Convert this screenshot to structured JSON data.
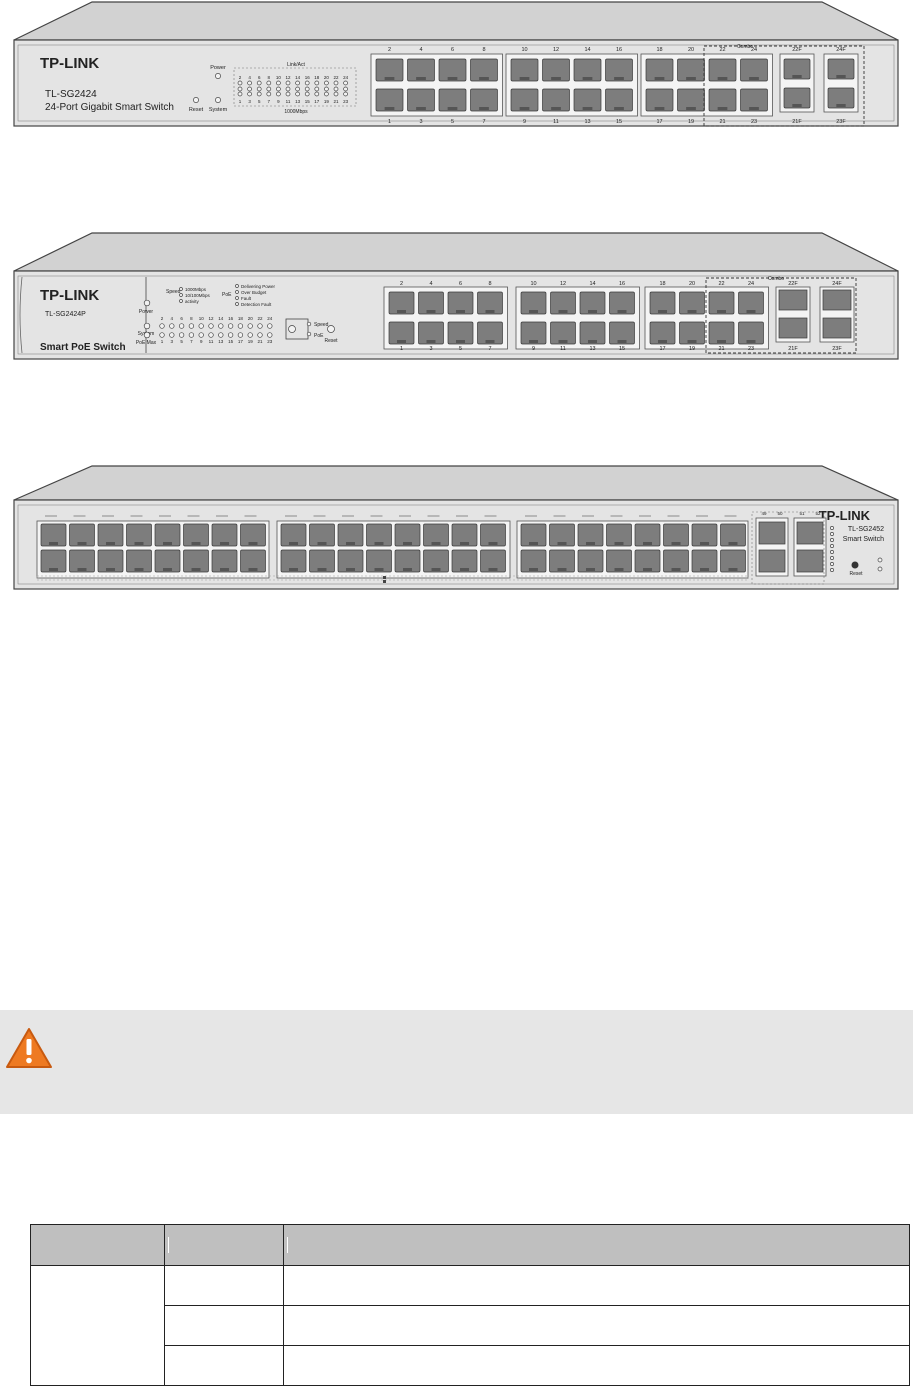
{
  "figures": {
    "switch_1": {
      "brand": "TP-LINK",
      "model": "TL-SG2424",
      "name": "24-Port Gigabit Smart Switch",
      "power_label": "Power",
      "reset_label": "Reset",
      "system_label": "System",
      "link_act_label": "Link/Act",
      "speed_label": "1000Mbps",
      "combo_label": "Combo",
      "led_top_numbers": [
        "2",
        "4",
        "6",
        "8",
        "10",
        "12",
        "14",
        "16",
        "18",
        "20",
        "22",
        "24"
      ],
      "led_bottom_numbers": [
        "1",
        "3",
        "5",
        "7",
        "9",
        "11",
        "13",
        "15",
        "17",
        "19",
        "21",
        "23"
      ],
      "port_top_numbers": [
        "2",
        "4",
        "6",
        "8",
        "10",
        "12",
        "14",
        "16",
        "18",
        "20",
        "22",
        "24"
      ],
      "port_bottom_numbers": [
        "1",
        "3",
        "5",
        "7",
        "9",
        "11",
        "13",
        "15",
        "17",
        "19",
        "21",
        "23"
      ],
      "sfp_top": [
        "22F",
        "24F"
      ],
      "sfp_bottom": [
        "21F",
        "23F"
      ]
    },
    "switch_2": {
      "brand": "TP-LINK",
      "model": "TL-SG2424P",
      "name": "Smart PoE Switch",
      "speed_label": "Speed",
      "speed_legend": [
        "1000Mbps",
        "10/100Mbps",
        "activity"
      ],
      "poe_label": "PoE",
      "poe_legend": [
        "Delivering Power",
        "Over Budget",
        "Fault",
        "Detection Fault"
      ],
      "power_label": "Power",
      "system_label": "System",
      "poe_max_label": "PoE Max",
      "speed_mode_label": "Speed",
      "poe_mode_label": "PoE",
      "reset_label": "Reset",
      "combo_label": "Combo",
      "led_top_numbers": [
        "2",
        "4",
        "6",
        "8",
        "10",
        "12",
        "14",
        "16",
        "18",
        "20",
        "22",
        "24"
      ],
      "led_bottom_numbers": [
        "1",
        "3",
        "5",
        "7",
        "9",
        "11",
        "13",
        "15",
        "17",
        "19",
        "21",
        "23"
      ],
      "port_top_numbers": [
        "2",
        "4",
        "6",
        "8",
        "10",
        "12",
        "14",
        "16",
        "18",
        "20",
        "22",
        "24"
      ],
      "port_bottom_numbers": [
        "1",
        "3",
        "5",
        "7",
        "9",
        "11",
        "13",
        "15",
        "17",
        "19",
        "21",
        "23"
      ],
      "sfp_top": [
        "22F",
        "24F"
      ],
      "sfp_bottom": [
        "21F",
        "23F"
      ]
    },
    "switch_3": {
      "brand": "TP-LINK",
      "model": "TL-SG2452",
      "name": "Smart Switch",
      "reset_label": "Reset",
      "sfp_numbers": [
        "49",
        "50",
        "51",
        "52"
      ],
      "speed_legend": [
        "1000Mbps",
        "10/100Mbps"
      ]
    }
  },
  "colors": {
    "panel": "#e4e4e4",
    "panel_top": "#d2d2d2",
    "port": "#7d7d7d",
    "warning_bg": "#e6e6e6",
    "warning_icon": "#ee7a22",
    "table_header": "#bfbfbf"
  },
  "warning": {
    "icon": "warning-triangle-icon"
  }
}
